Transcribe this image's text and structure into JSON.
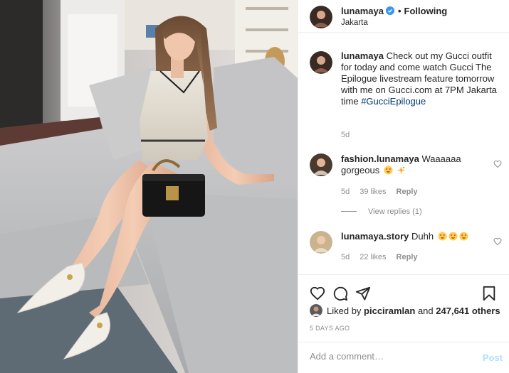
{
  "header": {
    "username": "lunamaya",
    "separator": "•",
    "follow_status": "Following",
    "location": "Jakarta"
  },
  "caption": {
    "username": "lunamaya",
    "text": "Check out my Gucci outfit for today and come watch Gucci The Epilogue livestream feature tomorrow with me on Gucci.com at 7PM Jakarta time",
    "hashtag": "#GucciEpilogue",
    "age": "5d"
  },
  "comments": [
    {
      "username": "fashion.lunamaya",
      "text": "Waaaaaa gorgeous",
      "emojis": [
        "heart-eyes-emoji",
        "sparkle-emoji"
      ],
      "age": "5d",
      "likes": "39 likes",
      "reply": "Reply"
    },
    {
      "username": "lunamaya.story",
      "text": "Duhh",
      "emojis": [
        "heart-eyes-emoji",
        "heart-eyes-emoji",
        "heart-eyes-emoji"
      ],
      "age": "5d",
      "likes": "22 likes",
      "reply": "Reply"
    }
  ],
  "view_replies": "View replies (1)",
  "likes": {
    "prefix": "Liked by",
    "user": "picciramlan",
    "joiner": "and",
    "count": "247,641 others"
  },
  "time_ago": "5 DAYS AGO",
  "add_comment": {
    "placeholder": "Add a comment…",
    "post_label": "Post"
  },
  "icons": [
    "verified-icon",
    "heart-icon",
    "comment-icon",
    "share-icon",
    "bookmark-icon"
  ],
  "colors": {
    "link": "#00376b",
    "muted": "#8e8e8e",
    "verified": "#3897f0",
    "post_disabled": "#b2dffc"
  }
}
